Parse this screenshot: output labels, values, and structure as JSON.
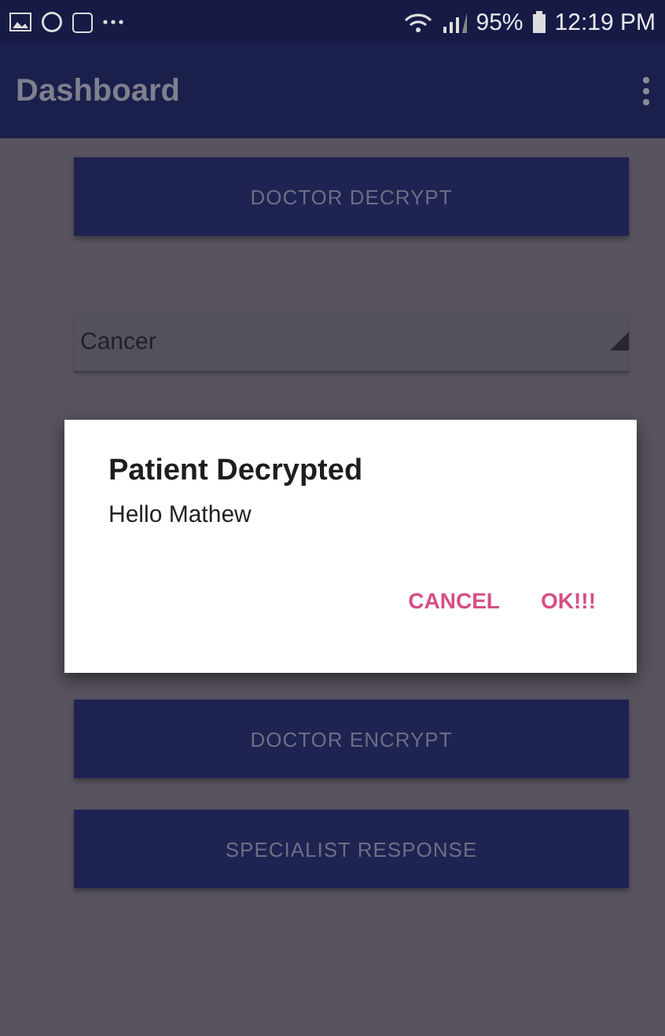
{
  "status_bar": {
    "battery": "95%",
    "time": "12:19 PM"
  },
  "app_bar": {
    "title": "Dashboard"
  },
  "buttons_top": [
    "DOCTOR DECRYPT"
  ],
  "spinner": {
    "value": "Cancer"
  },
  "buttons_bottom": [
    "DOCTOR ENCRYPT",
    "SPECIALIST RESPONSE"
  ],
  "dialog": {
    "title": "Patient Decrypted",
    "message": "Hello Mathew",
    "actions": [
      "CANCEL",
      "OK!!!"
    ]
  }
}
